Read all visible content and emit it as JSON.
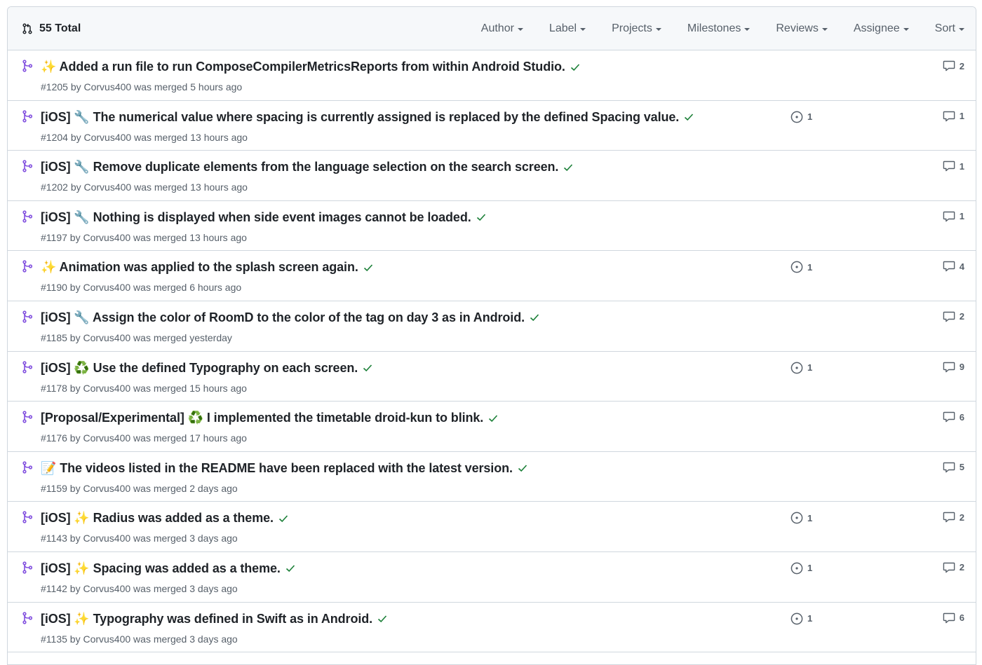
{
  "header": {
    "total_label": "55 Total",
    "filters": [
      "Author",
      "Label",
      "Projects",
      "Milestones",
      "Reviews",
      "Assignee",
      "Sort"
    ]
  },
  "colors": {
    "merged": "#8250df",
    "success": "#1a7f37",
    "muted": "#57606a",
    "border": "#d0d7de"
  },
  "pulls": [
    {
      "title": "✨ Added a run file to run ComposeCompilerMetricsReports from within Android Studio.",
      "meta": "#1205 by Corvus400 was merged 5 hours ago",
      "linked_issues": "",
      "comments": "2"
    },
    {
      "title": "[iOS] 🔧 The numerical value where spacing is currently assigned is replaced by the defined Spacing value.",
      "meta": "#1204 by Corvus400 was merged 13 hours ago",
      "linked_issues": "1",
      "comments": "1"
    },
    {
      "title": "[iOS] 🔧 Remove duplicate elements from the language selection on the search screen.",
      "meta": "#1202 by Corvus400 was merged 13 hours ago",
      "linked_issues": "",
      "comments": "1"
    },
    {
      "title": "[iOS] 🔧 Nothing is displayed when side event images cannot be loaded.",
      "meta": "#1197 by Corvus400 was merged 13 hours ago",
      "linked_issues": "",
      "comments": "1"
    },
    {
      "title": "✨ Animation was applied to the splash screen again.",
      "meta": "#1190 by Corvus400 was merged 6 hours ago",
      "linked_issues": "1",
      "comments": "4"
    },
    {
      "title": "[iOS] 🔧 Assign the color of RoomD to the color of the tag on day 3 as in Android.",
      "meta": "#1185 by Corvus400 was merged yesterday",
      "linked_issues": "",
      "comments": "2"
    },
    {
      "title": "[iOS] ♻️ Use the defined Typography on each screen.",
      "meta": "#1178 by Corvus400 was merged 15 hours ago",
      "linked_issues": "1",
      "comments": "9"
    },
    {
      "title": "[Proposal/Experimental] ♻️ I implemented the timetable droid-kun to blink.",
      "meta": "#1176 by Corvus400 was merged 17 hours ago",
      "linked_issues": "",
      "comments": "6"
    },
    {
      "title": "📝 The videos listed in the README have been replaced with the latest version.",
      "meta": "#1159 by Corvus400 was merged 2 days ago",
      "linked_issues": "",
      "comments": "5"
    },
    {
      "title": "[iOS] ✨ Radius was added as a theme.",
      "meta": "#1143 by Corvus400 was merged 3 days ago",
      "linked_issues": "1",
      "comments": "2"
    },
    {
      "title": "[iOS] ✨ Spacing was added as a theme.",
      "meta": "#1142 by Corvus400 was merged 3 days ago",
      "linked_issues": "1",
      "comments": "2"
    },
    {
      "title": "[iOS] ✨ Typography was defined in Swift as in Android.",
      "meta": "#1135 by Corvus400 was merged 3 days ago",
      "linked_issues": "1",
      "comments": "6"
    }
  ]
}
